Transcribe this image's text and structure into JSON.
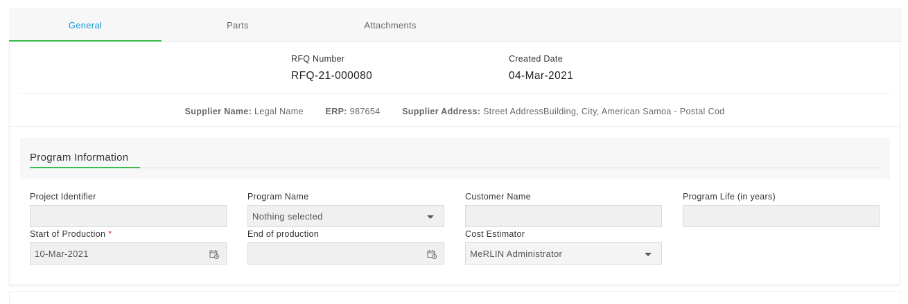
{
  "tabs": [
    {
      "label": "General",
      "active": true
    },
    {
      "label": "Parts",
      "active": false
    },
    {
      "label": "Attachments",
      "active": false
    }
  ],
  "rfq": {
    "number_label": "RFQ Number",
    "number_value": "RFQ-21-000080",
    "created_label": "Created Date",
    "created_value": "04-Mar-2021"
  },
  "supplier": {
    "name_label": "Supplier Name:",
    "name_value": "Legal Name",
    "erp_label": "ERP:",
    "erp_value": "987654",
    "address_label": "Supplier Address:",
    "address_value": "Street AddressBuilding, City, American Samoa - Postal Cod"
  },
  "program_information": {
    "title": "Program Information",
    "fields": {
      "project_identifier": {
        "label": "Project Identifier",
        "value": ""
      },
      "program_name": {
        "label": "Program Name",
        "value": "Nothing selected"
      },
      "customer_name": {
        "label": "Customer Name",
        "value": ""
      },
      "program_life": {
        "label": "Program Life (in years)",
        "value": ""
      },
      "start_of_production": {
        "label": "Start of Production",
        "required_mark": "*",
        "value": "10-Mar-2021"
      },
      "end_of_production": {
        "label": "End of production",
        "value": ""
      },
      "cost_estimator": {
        "label": "Cost Estimator",
        "value": "MeRLIN Administrator"
      }
    }
  },
  "colors": {
    "accent_green": "#3cb94a",
    "active_tab_text": "#1a9ad6",
    "required": "#e0392b"
  },
  "icons": {
    "dropdown": "chevron-down-icon",
    "date_picker": "calendar-icon"
  }
}
